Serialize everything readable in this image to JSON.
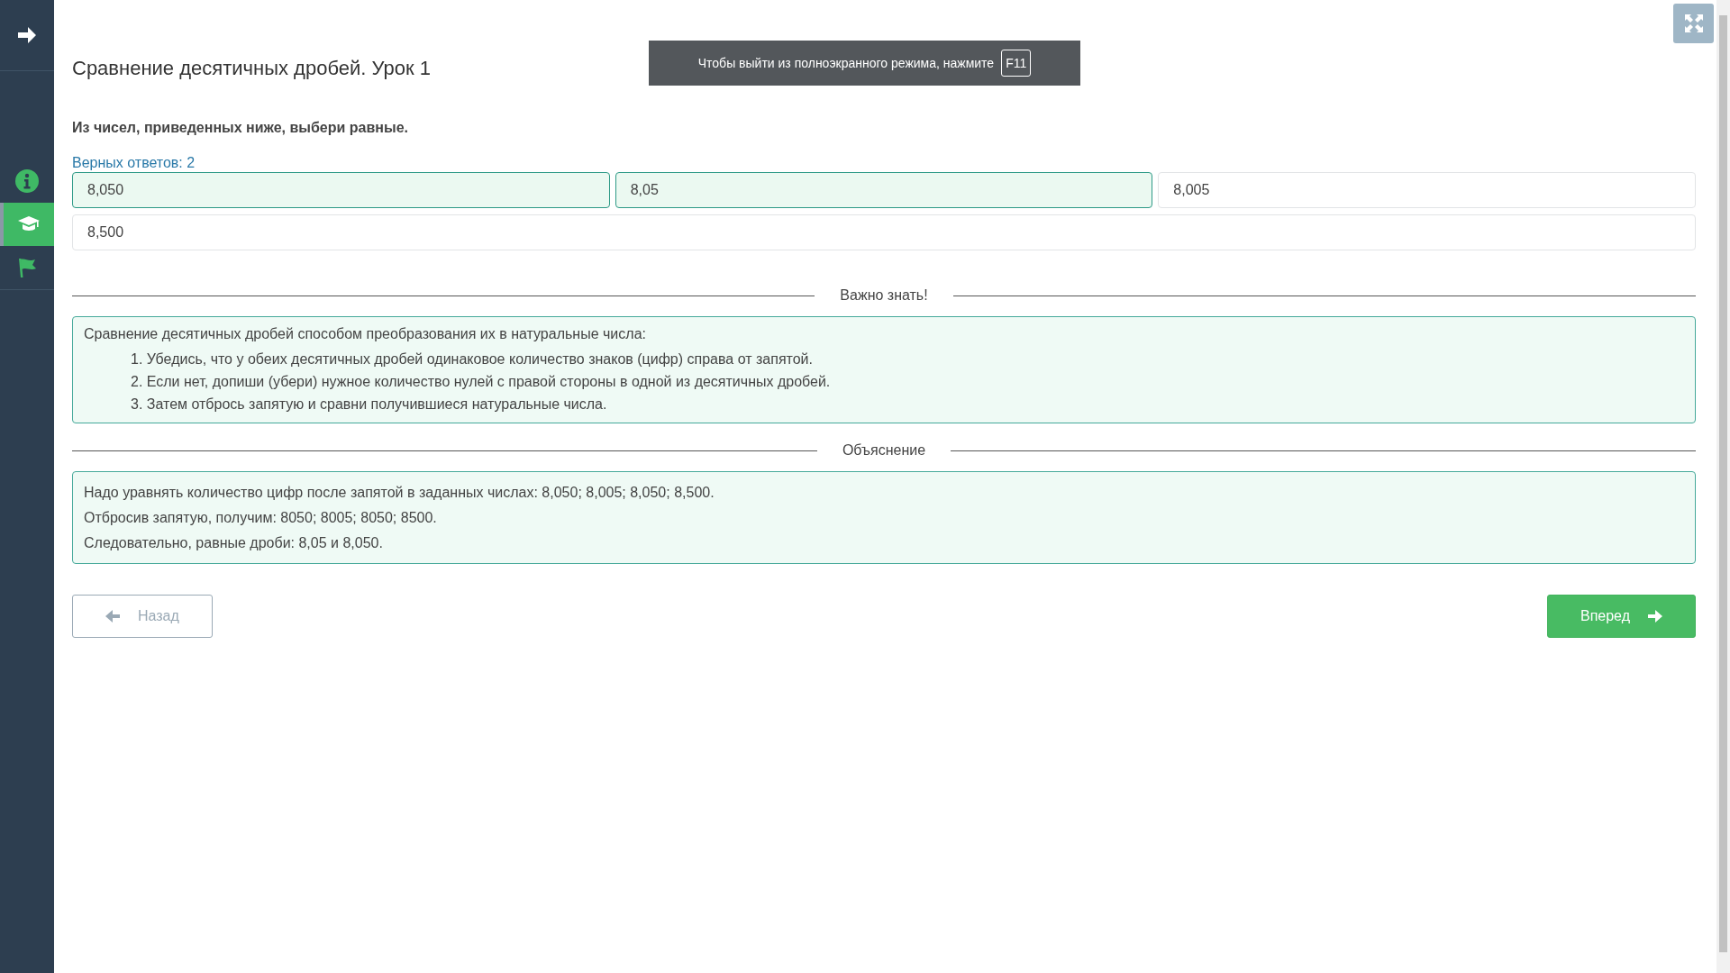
{
  "sidebar": {
    "items": [
      {
        "kind": "info",
        "selected": false
      },
      {
        "kind": "lesson",
        "selected": true
      },
      {
        "kind": "flag",
        "selected": false
      }
    ]
  },
  "fullscreen_notice": {
    "text": "Чтобы выйти из полноэкранного режима, нажмите",
    "key": "F11"
  },
  "title": "Сравнение десятичных дробей. Урок 1",
  "question": "Из чисел, приведенных ниже, выбери равные.",
  "answer_count": "Верных ответов: 2",
  "options": [
    {
      "label": "8,050",
      "selected": true
    },
    {
      "label": "8,05",
      "selected": true
    },
    {
      "label": "8,005",
      "selected": false
    },
    {
      "label": "8,500",
      "selected": false
    }
  ],
  "sections": [
    {
      "heading": "Важно знать!",
      "intro": "Сравнение десятичных дробей способом преобразования их в натуральные числа:",
      "steps": [
        "1. Убедись, что у обеих десятичных дробей одинаковое количество знаков (цифр) справа от запятой.",
        "2. Если нет, допиши (убери) нужное количество нулей с правой стороны в одной из десятичных дробей.",
        "3. Затем отбрось запятую и сравни получившиеся натуральные числа."
      ]
    },
    {
      "heading": "Объяснение",
      "paragraphs": [
        "Надо уравнять количество цифр после запятой в заданных числах: 8,050; 8,005; 8,050; 8,500.",
        "Отбросив запятую, получим: 8050; 8005; 8050; 8500.",
        "Следовательно, равные дроби: 8,05 и 8,050."
      ]
    }
  ],
  "navigation": [
    {
      "kind": "back",
      "label": "Назад",
      "disabled": true
    },
    {
      "kind": "next",
      "label": "Вперед",
      "disabled": false
    }
  ]
}
